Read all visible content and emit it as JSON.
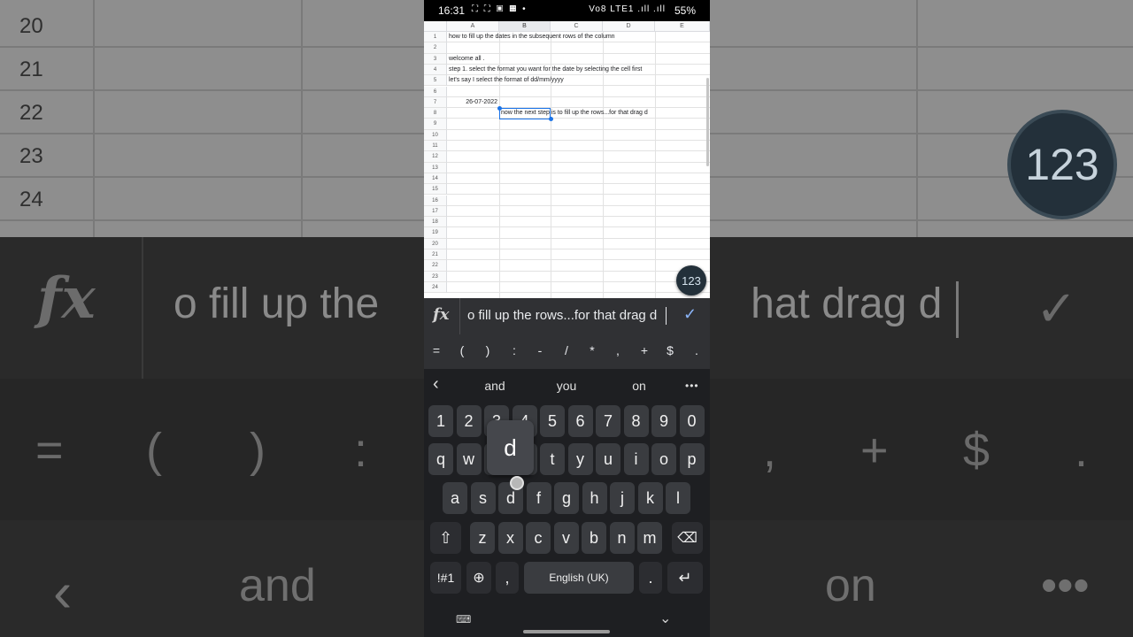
{
  "status_bar": {
    "time": "16:31",
    "notification_icons": "⛶ ⛶ ▣ ▦ •",
    "signal": "Vo8 LTE1 .ıll .ıll",
    "battery": "55%"
  },
  "sheet": {
    "columns": [
      "A",
      "B",
      "C",
      "D",
      "E"
    ],
    "selected_column": "B",
    "rows": [
      "1",
      "2",
      "3",
      "4",
      "5",
      "6",
      "7",
      "8",
      "9",
      "10",
      "11",
      "12",
      "13",
      "14",
      "15",
      "16",
      "17",
      "18",
      "19",
      "20",
      "21",
      "22",
      "23",
      "24"
    ],
    "cells": [
      {
        "row": 1,
        "col": "A",
        "text": "how to fill up the dates in the subsequent rows of the column"
      },
      {
        "row": 3,
        "col": "A",
        "text": "welcome all ."
      },
      {
        "row": 4,
        "col": "A",
        "text": "step 1.  select the format you want for the date by selecting the cell first"
      },
      {
        "row": 5,
        "col": "A",
        "text": "let's say I select the format of dd/mm/yyyy"
      },
      {
        "row": 7,
        "col": "A",
        "text": "26-07-2022",
        "align": "right"
      },
      {
        "row": 8,
        "col": "B",
        "text": "now the next step is to fill up the rows...for that drag d"
      }
    ],
    "selected_cell": "B8",
    "fab_label": "123"
  },
  "formula_bar": {
    "fx_label": "fx",
    "text": "o fill up the rows...for that drag d",
    "confirm_icon": "checkmark-icon"
  },
  "symbols": [
    "=",
    "(",
    ")",
    ":",
    "-",
    "/",
    "*",
    ",",
    "+",
    "$",
    "."
  ],
  "keyboard": {
    "suggestions": [
      "and",
      "you",
      "on"
    ],
    "back_icon": "chevron-left-icon",
    "more_icon": "more-dots-icon",
    "number_row": [
      "1",
      "2",
      "3",
      "4",
      "5",
      "6",
      "7",
      "8",
      "9",
      "0"
    ],
    "row_q": [
      "q",
      "w",
      "e",
      "r",
      "t",
      "y",
      "u",
      "i",
      "o",
      "p"
    ],
    "row_a": [
      "a",
      "s",
      "d",
      "f",
      "g",
      "h",
      "j",
      "k",
      "l"
    ],
    "row_z": [
      "z",
      "x",
      "c",
      "v",
      "b",
      "n",
      "m"
    ],
    "shift_icon": "shift-icon",
    "backspace_icon": "backspace-icon",
    "symbols_key": "!#1",
    "globe_icon": "globe-icon",
    "comma_key": ",",
    "space_label": "English (UK)",
    "period_key": ".",
    "enter_icon": "enter-icon",
    "popup_key": "d"
  },
  "background_zoom": {
    "row_numbers": [
      "20",
      "21",
      "22",
      "23",
      "24"
    ],
    "fab_label": "123",
    "fx_label": "fx",
    "formula_text": "o fill up the",
    "formula_text_right": "hat drag d",
    "symbols": [
      "=",
      "(",
      ")",
      ":",
      ",",
      "+",
      "$",
      "."
    ],
    "suggestions": [
      "and",
      "on"
    ]
  }
}
